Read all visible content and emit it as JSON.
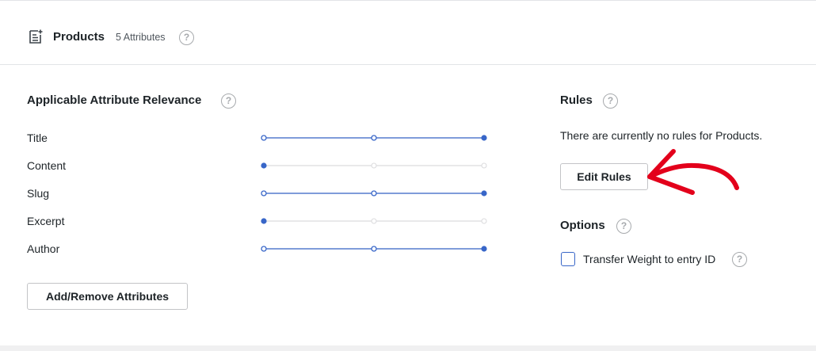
{
  "header": {
    "icon": "document-plus-icon",
    "title": "Products",
    "attribute_count": "5 Attributes",
    "help_glyph": "?"
  },
  "relevance": {
    "title": "Applicable Attribute Relevance",
    "help_glyph": "?",
    "accent_color": "#3866c8",
    "inactive_color": "#dcdcde",
    "attributes": [
      {
        "label": "Title",
        "level": 3,
        "max": 3
      },
      {
        "label": "Content",
        "level": 1,
        "max": 3
      },
      {
        "label": "Slug",
        "level": 3,
        "max": 3
      },
      {
        "label": "Excerpt",
        "level": 1,
        "max": 3
      },
      {
        "label": "Author",
        "level": 3,
        "max": 3
      }
    ],
    "add_remove_label": "Add/Remove Attributes"
  },
  "rules": {
    "title": "Rules",
    "help_glyph": "?",
    "empty_text": "There are currently no rules for Products.",
    "edit_label": "Edit Rules",
    "annotation_arrow_color": "#e3001b"
  },
  "options": {
    "title": "Options",
    "help_glyph": "?",
    "transfer_weight_label": "Transfer Weight to entry ID",
    "transfer_weight_checked": false
  }
}
